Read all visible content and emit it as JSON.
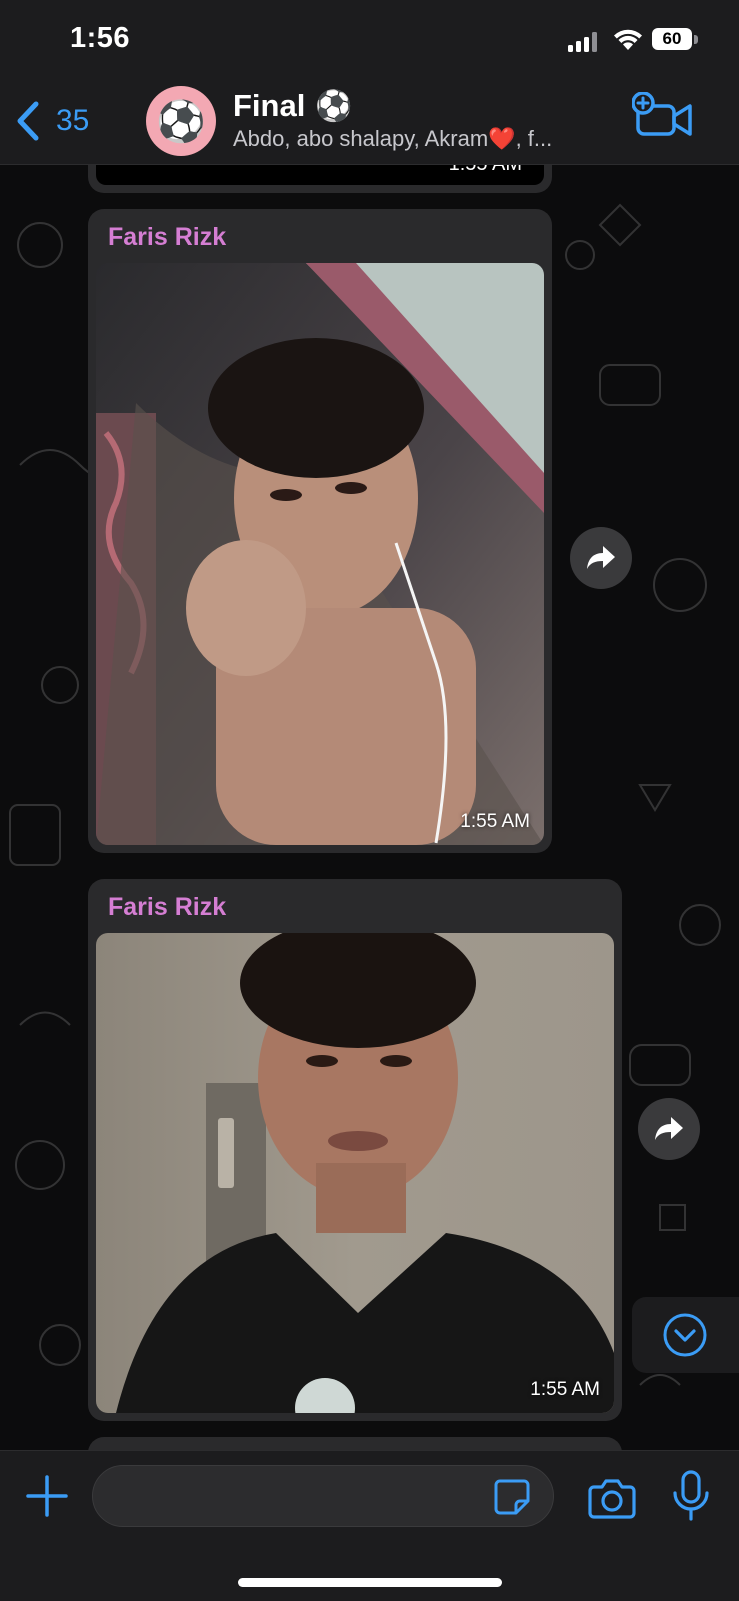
{
  "status_bar": {
    "time": "1:56",
    "battery": "60"
  },
  "header": {
    "back_count": "35",
    "title": "Final",
    "title_emoji": "⚽",
    "avatar_emoji": "⚽",
    "subtitle": "Abdo, abo shalapy, Akram❤️, f..."
  },
  "messages": [
    {
      "time": "1:55 AM"
    },
    {
      "sender": "Faris Rizk",
      "type": "photo",
      "time": "1:55 AM"
    },
    {
      "sender": "Faris Rizk",
      "type": "photo",
      "time": "1:55 AM"
    }
  ],
  "composer": {
    "value": "",
    "placeholder": ""
  },
  "colors": {
    "accent": "#3b9cf5",
    "sender_name": "#d57ed3",
    "bubble": "#2a2a2c",
    "bar": "#1c1c1e"
  },
  "icons": {
    "back": "chevron-left-icon",
    "video": "video-call-plus-icon",
    "forward": "forward-arrow-icon",
    "scroll_down": "chevron-down-circle-icon",
    "plus": "plus-icon",
    "sticker": "sticker-icon",
    "camera": "camera-icon",
    "mic": "microphone-icon"
  }
}
